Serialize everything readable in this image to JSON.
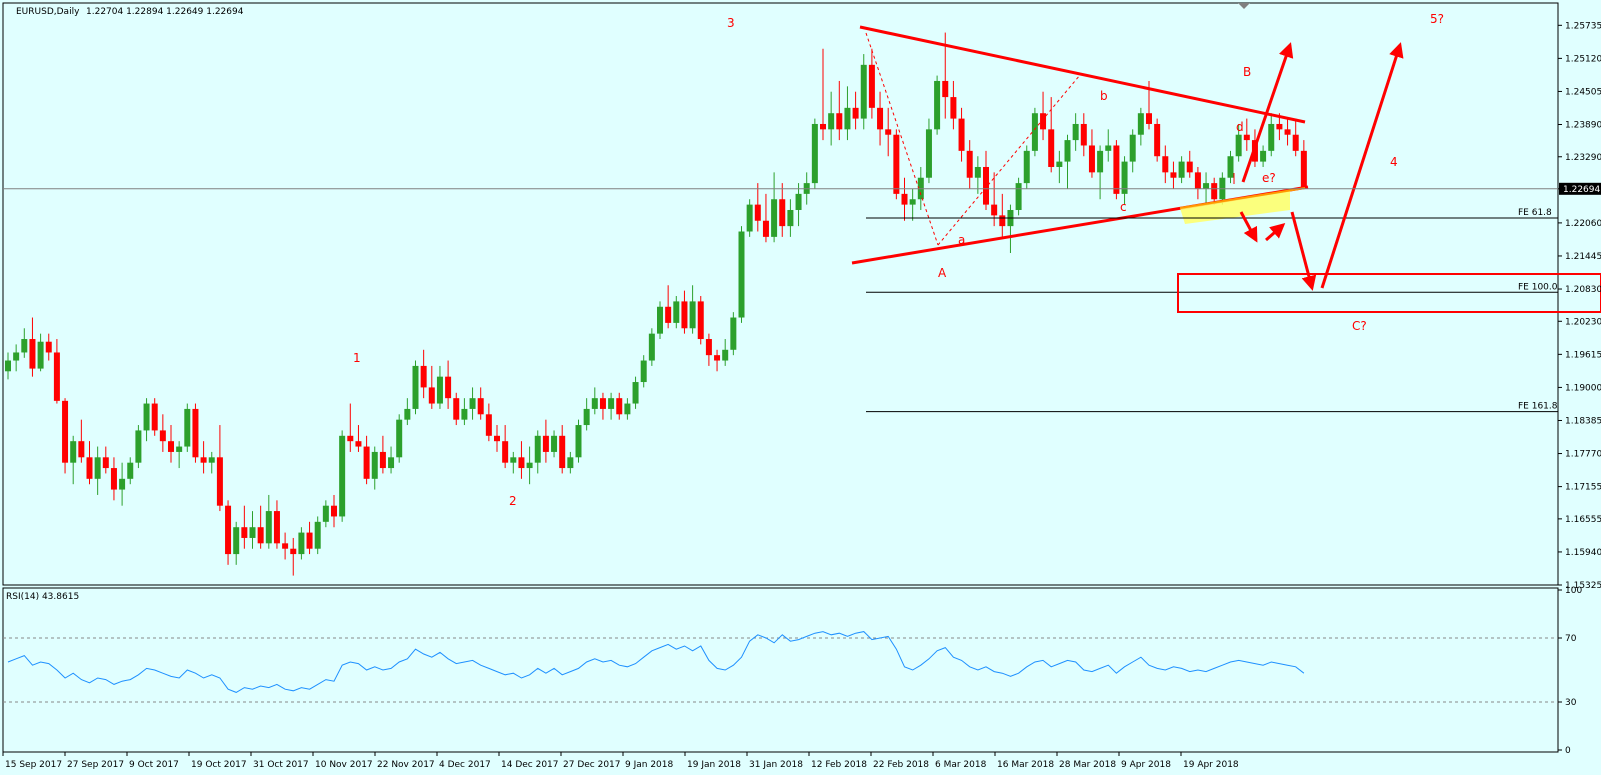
{
  "header": {
    "symbol": "EURUSD,Daily",
    "ohlc": "1.22704 1.22894 1.22649 1.22694"
  },
  "rsi_header": "RSI(14) 43.8615",
  "colors": {
    "background": "#e0ffff",
    "bull": "#2ca02c",
    "bear": "#ff0000",
    "annotation": "#ff0000",
    "rsi_line": "#1e90ff",
    "highlight": "#ffff66"
  },
  "chart_data": [
    {
      "type": "candlestick",
      "title": "EURUSD,Daily",
      "ylim": [
        1.15325,
        1.2615
      ],
      "y_ticks": [
        "1.25735",
        "1.25120",
        "1.24505",
        "1.23890",
        "1.23290",
        "1.22694",
        "1.22060",
        "1.21445",
        "1.20830",
        "1.20230",
        "1.19615",
        "1.19000",
        "1.18385",
        "1.17770",
        "1.17155",
        "1.16555",
        "1.15940",
        "1.15325"
      ],
      "x_ticks": [
        "15 Sep 2017",
        "27 Sep 2017",
        "9 Oct 2017",
        "19 Oct 2017",
        "31 Oct 2017",
        "10 Nov 2017",
        "22 Nov 2017",
        "4 Dec 2017",
        "14 Dec 2017",
        "27 Dec 2017",
        "9 Jan 2018",
        "19 Jan 2018",
        "31 Jan 2018",
        "12 Feb 2018",
        "22 Feb 2018",
        "6 Mar 2018",
        "16 Mar 2018",
        "28 Mar 2018",
        "9 Apr 2018",
        "19 Apr 2018"
      ],
      "current_price": 1.22694,
      "candles": [
        [
          1.193,
          1.1965,
          1.1915,
          1.195
        ],
        [
          1.195,
          1.198,
          1.193,
          1.1965
        ],
        [
          1.1965,
          1.201,
          1.1955,
          1.199
        ],
        [
          1.199,
          1.203,
          1.192,
          1.1935
        ],
        [
          1.1935,
          1.2,
          1.193,
          1.1985
        ],
        [
          1.1985,
          1.2,
          1.195,
          1.1965
        ],
        [
          1.1965,
          1.199,
          1.187,
          1.1875
        ],
        [
          1.1875,
          1.188,
          1.174,
          1.176
        ],
        [
          1.176,
          1.181,
          1.172,
          1.18
        ],
        [
          1.18,
          1.184,
          1.176,
          1.177
        ],
        [
          1.177,
          1.18,
          1.172,
          1.173
        ],
        [
          1.173,
          1.179,
          1.17,
          1.177
        ],
        [
          1.177,
          1.179,
          1.174,
          1.175
        ],
        [
          1.175,
          1.177,
          1.169,
          1.171
        ],
        [
          1.171,
          1.176,
          1.168,
          1.173
        ],
        [
          1.173,
          1.177,
          1.172,
          1.176
        ],
        [
          1.176,
          1.183,
          1.175,
          1.182
        ],
        [
          1.182,
          1.188,
          1.18,
          1.187
        ],
        [
          1.187,
          1.188,
          1.181,
          1.182
        ],
        [
          1.182,
          1.185,
          1.178,
          1.18
        ],
        [
          1.18,
          1.183,
          1.176,
          1.178
        ],
        [
          1.178,
          1.18,
          1.175,
          1.179
        ],
        [
          1.179,
          1.187,
          1.178,
          1.186
        ],
        [
          1.186,
          1.187,
          1.176,
          1.177
        ],
        [
          1.177,
          1.18,
          1.174,
          1.176
        ],
        [
          1.176,
          1.178,
          1.174,
          1.177
        ],
        [
          1.177,
          1.183,
          1.167,
          1.168
        ],
        [
          1.168,
          1.169,
          1.157,
          1.159
        ],
        [
          1.159,
          1.165,
          1.157,
          1.164
        ],
        [
          1.164,
          1.168,
          1.16,
          1.162
        ],
        [
          1.162,
          1.167,
          1.16,
          1.164
        ],
        [
          1.164,
          1.168,
          1.16,
          1.161
        ],
        [
          1.161,
          1.17,
          1.16,
          1.167
        ],
        [
          1.167,
          1.169,
          1.16,
          1.161
        ],
        [
          1.161,
          1.163,
          1.158,
          1.16
        ],
        [
          1.16,
          1.162,
          1.155,
          1.159
        ],
        [
          1.159,
          1.164,
          1.158,
          1.163
        ],
        [
          1.163,
          1.165,
          1.159,
          1.16
        ],
        [
          1.16,
          1.166,
          1.159,
          1.165
        ],
        [
          1.165,
          1.169,
          1.164,
          1.168
        ],
        [
          1.168,
          1.17,
          1.164,
          1.166
        ],
        [
          1.166,
          1.182,
          1.165,
          1.181
        ],
        [
          1.181,
          1.187,
          1.178,
          1.18
        ],
        [
          1.18,
          1.183,
          1.178,
          1.179
        ],
        [
          1.179,
          1.181,
          1.172,
          1.173
        ],
        [
          1.173,
          1.179,
          1.171,
          1.178
        ],
        [
          1.178,
          1.181,
          1.174,
          1.175
        ],
        [
          1.175,
          1.179,
          1.174,
          1.177
        ],
        [
          1.177,
          1.185,
          1.176,
          1.184
        ],
        [
          1.184,
          1.188,
          1.183,
          1.186
        ],
        [
          1.186,
          1.195,
          1.185,
          1.194
        ],
        [
          1.194,
          1.197,
          1.188,
          1.19
        ],
        [
          1.19,
          1.194,
          1.186,
          1.187
        ],
        [
          1.187,
          1.194,
          1.186,
          1.192
        ],
        [
          1.192,
          1.195,
          1.186,
          1.188
        ],
        [
          1.188,
          1.189,
          1.183,
          1.184
        ],
        [
          1.184,
          1.188,
          1.183,
          1.186
        ],
        [
          1.186,
          1.19,
          1.184,
          1.188
        ],
        [
          1.188,
          1.19,
          1.184,
          1.185
        ],
        [
          1.185,
          1.187,
          1.18,
          1.181
        ],
        [
          1.181,
          1.183,
          1.178,
          1.18
        ],
        [
          1.18,
          1.183,
          1.175,
          1.176
        ],
        [
          1.176,
          1.178,
          1.174,
          1.177
        ],
        [
          1.177,
          1.18,
          1.173,
          1.175
        ],
        [
          1.175,
          1.179,
          1.172,
          1.176
        ],
        [
          1.176,
          1.182,
          1.174,
          1.181
        ],
        [
          1.181,
          1.184,
          1.176,
          1.178
        ],
        [
          1.178,
          1.182,
          1.177,
          1.181
        ],
        [
          1.181,
          1.183,
          1.174,
          1.175
        ],
        [
          1.175,
          1.178,
          1.174,
          1.177
        ],
        [
          1.177,
          1.184,
          1.176,
          1.183
        ],
        [
          1.183,
          1.188,
          1.182,
          1.186
        ],
        [
          1.186,
          1.19,
          1.185,
          1.188
        ],
        [
          1.188,
          1.189,
          1.184,
          1.186
        ],
        [
          1.186,
          1.189,
          1.184,
          1.188
        ],
        [
          1.188,
          1.189,
          1.184,
          1.185
        ],
        [
          1.185,
          1.188,
          1.184,
          1.187
        ],
        [
          1.187,
          1.192,
          1.186,
          1.191
        ],
        [
          1.191,
          1.196,
          1.19,
          1.195
        ],
        [
          1.195,
          1.201,
          1.194,
          1.2
        ],
        [
          1.2,
          1.206,
          1.199,
          1.205
        ],
        [
          1.205,
          1.209,
          1.201,
          1.202
        ],
        [
          1.202,
          1.207,
          1.201,
          1.206
        ],
        [
          1.206,
          1.208,
          1.2,
          1.201
        ],
        [
          1.201,
          1.209,
          1.2,
          1.206
        ],
        [
          1.206,
          1.207,
          1.198,
          1.199
        ],
        [
          1.199,
          1.2,
          1.194,
          1.196
        ],
        [
          1.196,
          1.197,
          1.193,
          1.195
        ],
        [
          1.195,
          1.199,
          1.194,
          1.197
        ],
        [
          1.197,
          1.204,
          1.196,
          1.203
        ],
        [
          1.203,
          1.22,
          1.202,
          1.219
        ],
        [
          1.219,
          1.225,
          1.218,
          1.224
        ],
        [
          1.224,
          1.228,
          1.219,
          1.221
        ],
        [
          1.221,
          1.226,
          1.217,
          1.218
        ],
        [
          1.218,
          1.23,
          1.217,
          1.225
        ],
        [
          1.225,
          1.228,
          1.218,
          1.22
        ],
        [
          1.22,
          1.225,
          1.218,
          1.223
        ],
        [
          1.223,
          1.228,
          1.22,
          1.226
        ],
        [
          1.226,
          1.23,
          1.224,
          1.228
        ],
        [
          1.228,
          1.24,
          1.227,
          1.239
        ],
        [
          1.239,
          1.253,
          1.236,
          1.238
        ],
        [
          1.238,
          1.245,
          1.235,
          1.241
        ],
        [
          1.241,
          1.247,
          1.236,
          1.238
        ],
        [
          1.238,
          1.246,
          1.236,
          1.242
        ],
        [
          1.242,
          1.245,
          1.238,
          1.24
        ],
        [
          1.24,
          1.252,
          1.238,
          1.25
        ],
        [
          1.25,
          1.253,
          1.24,
          1.242
        ],
        [
          1.242,
          1.245,
          1.235,
          1.238
        ],
        [
          1.238,
          1.242,
          1.233,
          1.237
        ],
        [
          1.237,
          1.238,
          1.225,
          1.226
        ],
        [
          1.226,
          1.229,
          1.221,
          1.224
        ],
        [
          1.224,
          1.227,
          1.221,
          1.225
        ],
        [
          1.225,
          1.231,
          1.223,
          1.229
        ],
        [
          1.229,
          1.24,
          1.228,
          1.238
        ],
        [
          1.238,
          1.248,
          1.237,
          1.247
        ],
        [
          1.247,
          1.256,
          1.24,
          1.244
        ],
        [
          1.244,
          1.247,
          1.238,
          1.24
        ],
        [
          1.24,
          1.242,
          1.232,
          1.234
        ],
        [
          1.234,
          1.236,
          1.227,
          1.229
        ],
        [
          1.229,
          1.233,
          1.226,
          1.231
        ],
        [
          1.231,
          1.234,
          1.223,
          1.224
        ],
        [
          1.224,
          1.23,
          1.22,
          1.222
        ],
        [
          1.222,
          1.226,
          1.218,
          1.22
        ],
        [
          1.22,
          1.224,
          1.215,
          1.223
        ],
        [
          1.223,
          1.229,
          1.222,
          1.228
        ],
        [
          1.228,
          1.235,
          1.227,
          1.234
        ],
        [
          1.234,
          1.242,
          1.233,
          1.241
        ],
        [
          1.241,
          1.245,
          1.236,
          1.238
        ],
        [
          1.238,
          1.244,
          1.23,
          1.231
        ],
        [
          1.231,
          1.234,
          1.228,
          1.232
        ],
        [
          1.232,
          1.237,
          1.227,
          1.236
        ],
        [
          1.236,
          1.241,
          1.234,
          1.239
        ],
        [
          1.239,
          1.241,
          1.233,
          1.235
        ],
        [
          1.235,
          1.238,
          1.229,
          1.23
        ],
        [
          1.23,
          1.235,
          1.225,
          1.234
        ],
        [
          1.234,
          1.238,
          1.232,
          1.235
        ],
        [
          1.235,
          1.236,
          1.225,
          1.226
        ],
        [
          1.226,
          1.233,
          1.224,
          1.232
        ],
        [
          1.232,
          1.238,
          1.23,
          1.237
        ],
        [
          1.237,
          1.242,
          1.235,
          1.241
        ],
        [
          1.241,
          1.247,
          1.238,
          1.239
        ],
        [
          1.239,
          1.24,
          1.232,
          1.233
        ],
        [
          1.233,
          1.235,
          1.228,
          1.23
        ],
        [
          1.23,
          1.232,
          1.227,
          1.229
        ],
        [
          1.229,
          1.233,
          1.228,
          1.232
        ],
        [
          1.232,
          1.234,
          1.229,
          1.23
        ],
        [
          1.23,
          1.231,
          1.225,
          1.227
        ],
        [
          1.227,
          1.23,
          1.224,
          1.228
        ],
        [
          1.228,
          1.229,
          1.224,
          1.225
        ],
        [
          1.225,
          1.23,
          1.224,
          1.229
        ],
        [
          1.229,
          1.234,
          1.228,
          1.233
        ],
        [
          1.233,
          1.239,
          1.232,
          1.237
        ],
        [
          1.237,
          1.24,
          1.234,
          1.236
        ],
        [
          1.236,
          1.238,
          1.231,
          1.232
        ],
        [
          1.232,
          1.235,
          1.231,
          1.234
        ],
        [
          1.234,
          1.241,
          1.233,
          1.239
        ],
        [
          1.239,
          1.241,
          1.236,
          1.238
        ],
        [
          1.238,
          1.24,
          1.235,
          1.237
        ],
        [
          1.237,
          1.24,
          1.233,
          1.234
        ],
        [
          1.234,
          1.236,
          1.227,
          1.227
        ]
      ]
    },
    {
      "type": "line",
      "title": "RSI(14) 43.8615",
      "ylim": [
        0,
        100
      ],
      "y_ticks": [
        "100",
        "70",
        "30",
        "0"
      ],
      "levels": [
        70,
        30
      ],
      "values": [
        55,
        57,
        59,
        53,
        55,
        54,
        50,
        45,
        48,
        44,
        42,
        45,
        44,
        41,
        43,
        44,
        47,
        51,
        50,
        48,
        46,
        45,
        50,
        48,
        45,
        47,
        45,
        38,
        36,
        39,
        38,
        40,
        39,
        41,
        38,
        37,
        39,
        38,
        41,
        44,
        43,
        53,
        55,
        54,
        50,
        52,
        50,
        51,
        55,
        57,
        63,
        60,
        58,
        61,
        57,
        54,
        55,
        56,
        53,
        51,
        49,
        47,
        48,
        45,
        47,
        51,
        48,
        51,
        47,
        49,
        51,
        55,
        57,
        55,
        56,
        53,
        52,
        54,
        58,
        62,
        64,
        66,
        63,
        65,
        62,
        65,
        56,
        51,
        50,
        53,
        58,
        68,
        72,
        70,
        67,
        72,
        68,
        69,
        71,
        73,
        74,
        72,
        73,
        71,
        73,
        74,
        69,
        70,
        71,
        63,
        52,
        50,
        53,
        57,
        62,
        64,
        58,
        56,
        52,
        50,
        52,
        49,
        48,
        46,
        48,
        52,
        55,
        56,
        52,
        54,
        56,
        55,
        50,
        49,
        51,
        53,
        48,
        52,
        55,
        58,
        53,
        51,
        50,
        52,
        51,
        49,
        50,
        49,
        51,
        53,
        55,
        56,
        55,
        54,
        53,
        55,
        54,
        53,
        52,
        48
      ]
    }
  ],
  "annotations": {
    "wave_labels": [
      "1",
      "2",
      "3",
      "4",
      "5?",
      "A",
      "B",
      "C?",
      "a",
      "b",
      "c",
      "d",
      "e?"
    ],
    "fib_levels": [
      "FE 61.8",
      "FE 100.0",
      "FE 161.8"
    ]
  }
}
